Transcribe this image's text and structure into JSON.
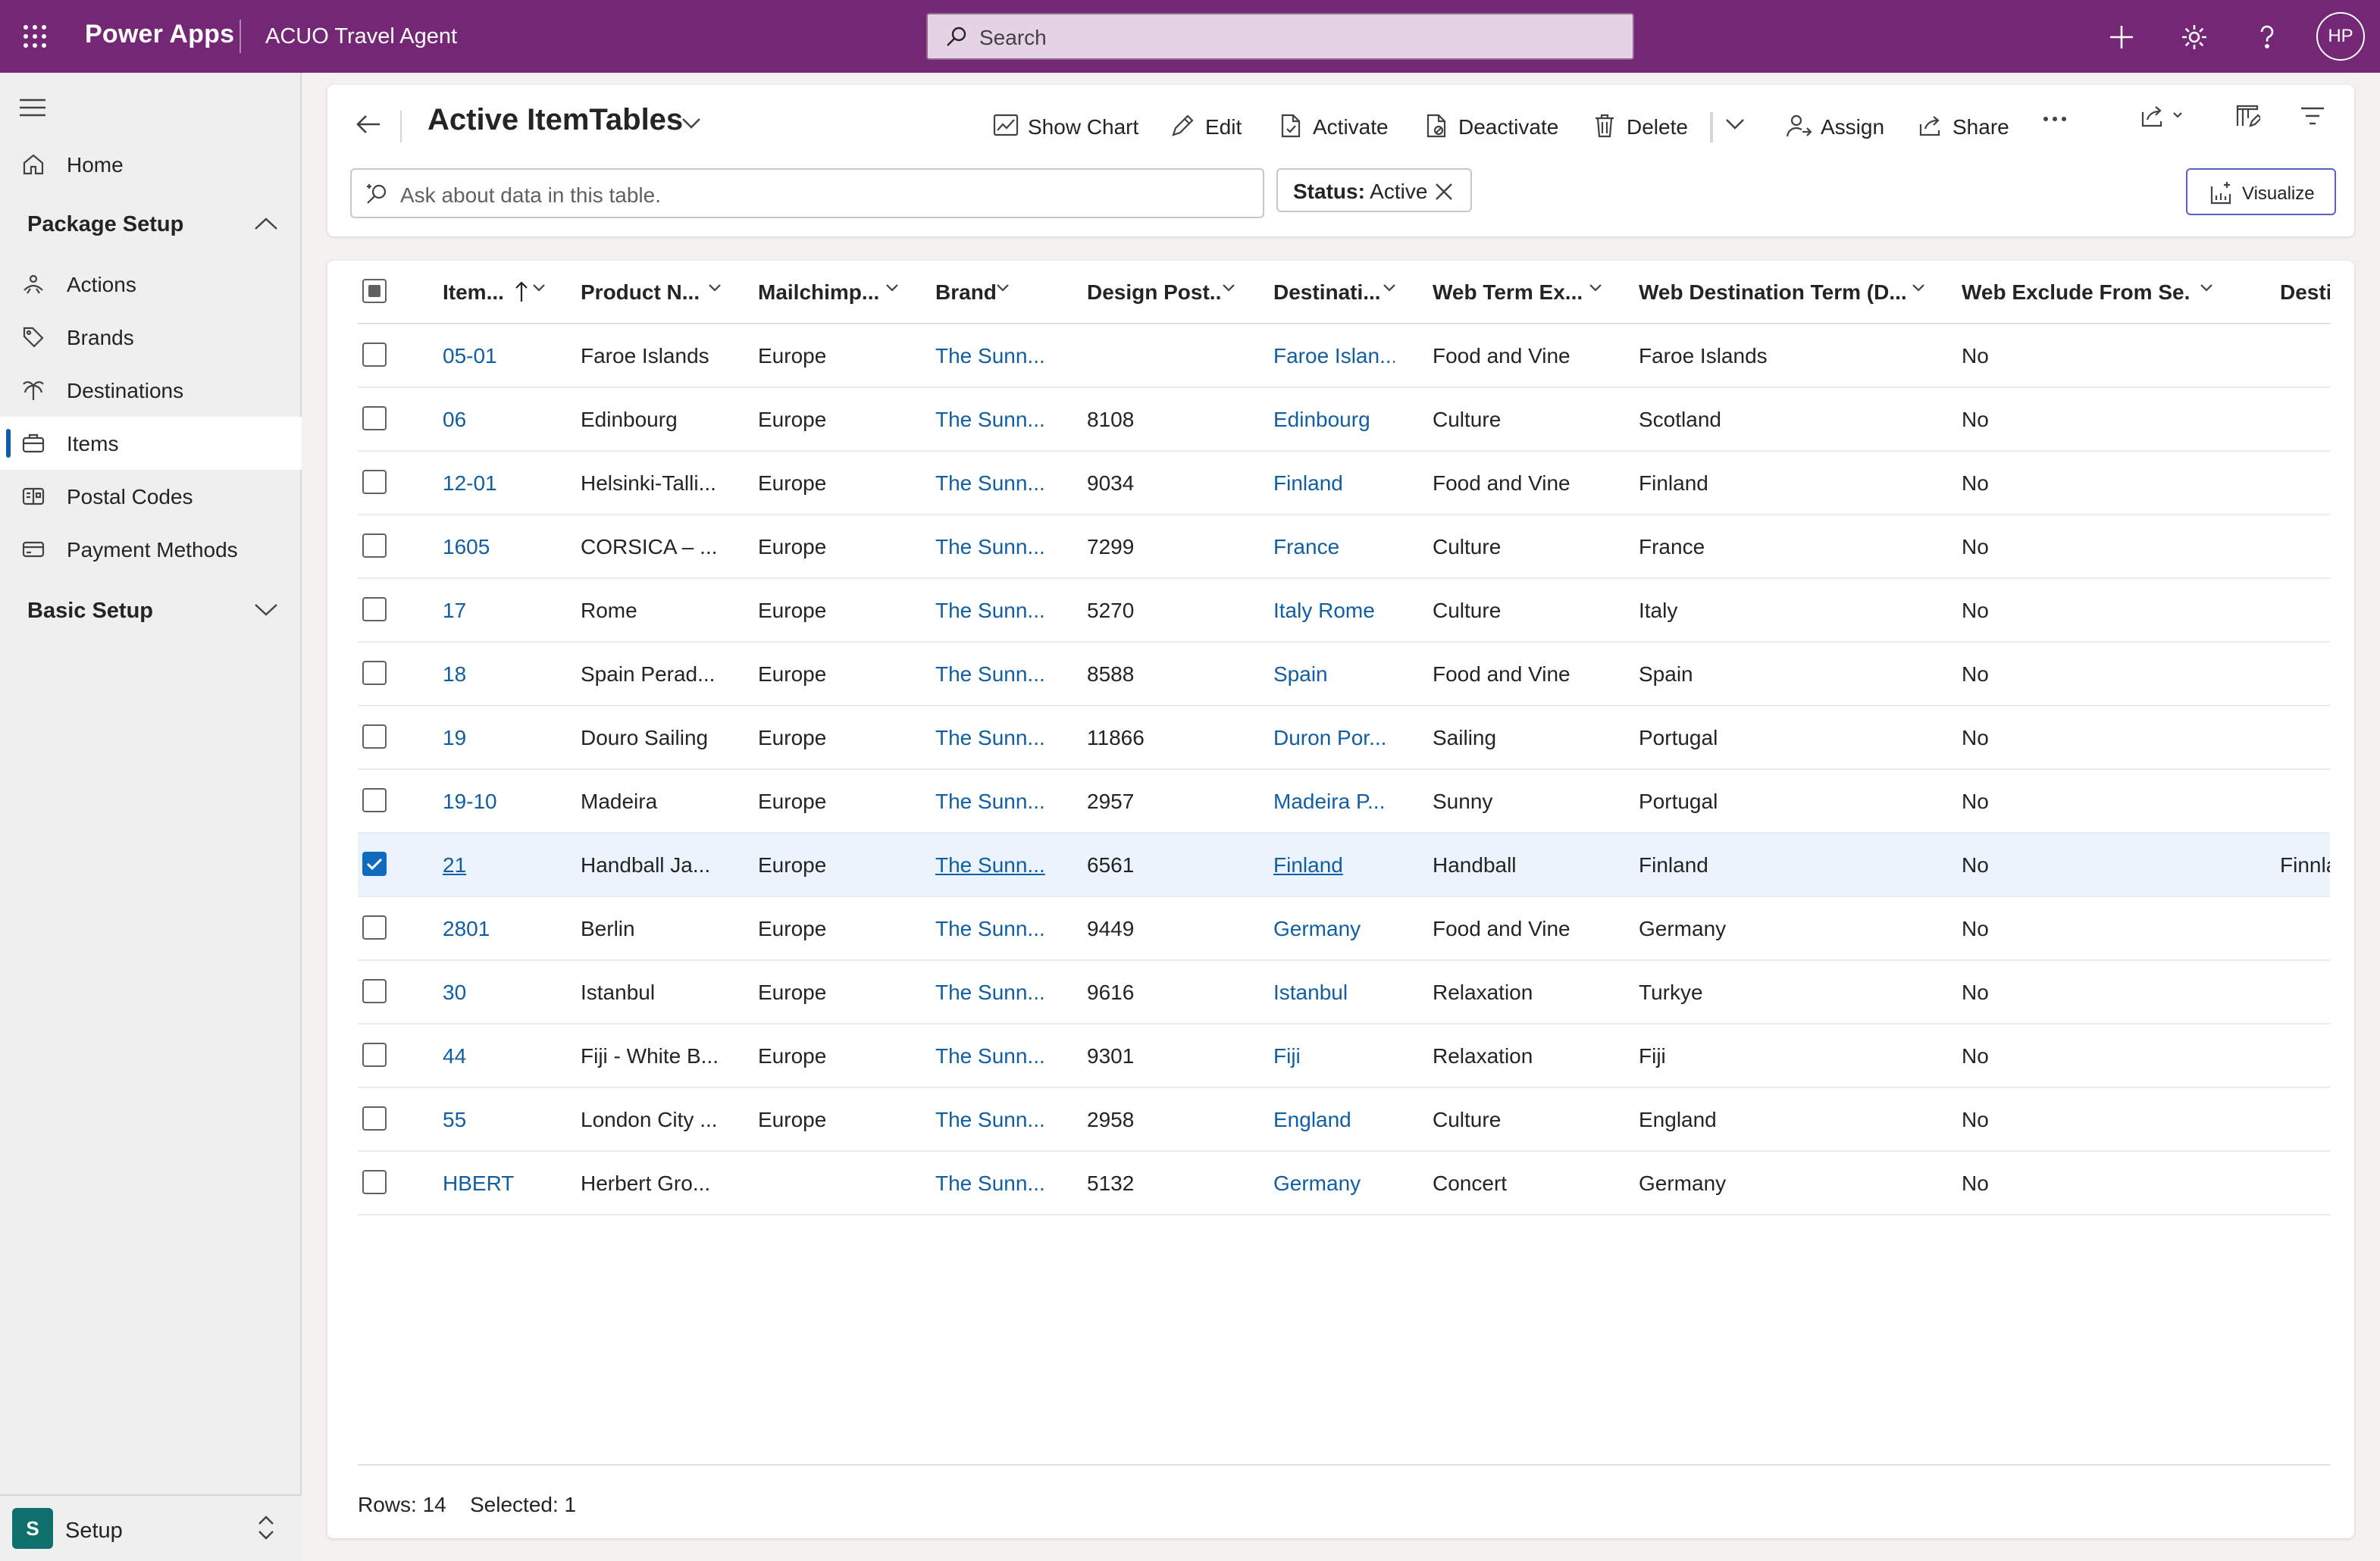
{
  "topbar": {
    "app_name": "Power Apps",
    "environment": "ACUO Travel Agent",
    "search_placeholder": "Search",
    "avatar_initials": "HP"
  },
  "sidebar": {
    "items": [
      {
        "label": "Home",
        "icon": "home-icon"
      },
      {
        "label": "Actions",
        "icon": "actions-icon"
      },
      {
        "label": "Brands",
        "icon": "tag-icon"
      },
      {
        "label": "Destinations",
        "icon": "palm-tree-icon"
      },
      {
        "label": "Items",
        "icon": "suitcase-icon",
        "selected": true
      },
      {
        "label": "Postal Codes",
        "icon": "postal-icon"
      },
      {
        "label": "Payment Methods",
        "icon": "payment-card-icon"
      }
    ],
    "groups": [
      {
        "label": "Package Setup",
        "expanded": true
      },
      {
        "label": "Basic Setup",
        "expanded": false
      }
    ],
    "area": {
      "badge": "S",
      "label": "Setup"
    }
  },
  "commandbar": {
    "view_title": "Active ItemTables",
    "buttons": {
      "show_chart": "Show Chart",
      "edit": "Edit",
      "activate": "Activate",
      "deactivate": "Deactivate",
      "delete": "Delete",
      "assign": "Assign",
      "share": "Share"
    },
    "ask_placeholder": "Ask about data in this table.",
    "filter_chip": {
      "label": "Status:",
      "value": "Active"
    },
    "visualize": "Visualize"
  },
  "grid": {
    "columns": [
      "Item...",
      "Product N...",
      "Mailchimp...",
      "Brand",
      "Design Post...",
      "Destinati...",
      "Web Term Ex...",
      "Web Destination Term (D...",
      "Web Exclude From Se...",
      "Destin"
    ],
    "rows": [
      {
        "item": "05-01",
        "product": "Faroe Islands",
        "mailchimp": "Europe",
        "brand": "The Sunn...",
        "design_post": "",
        "destination": "Faroe Islan...",
        "web_term": "Food and Vine",
        "web_dest_term": "Faroe Islands",
        "web_exclude": "No",
        "extra": ""
      },
      {
        "item": "06",
        "product": "Edinbourg",
        "mailchimp": "Europe",
        "brand": "The Sunn...",
        "design_post": "8108",
        "destination": "Edinbourg",
        "web_term": "Culture",
        "web_dest_term": "Scotland",
        "web_exclude": "No",
        "extra": ""
      },
      {
        "item": "12-01",
        "product": "Helsinki-Talli...",
        "mailchimp": "Europe",
        "brand": "The Sunn...",
        "design_post": "9034",
        "destination": "Finland",
        "web_term": "Food and Vine",
        "web_dest_term": "Finland",
        "web_exclude": "No",
        "extra": ""
      },
      {
        "item": "1605",
        "product": "CORSICA – ...",
        "mailchimp": "Europe",
        "brand": "The Sunn...",
        "design_post": "7299",
        "destination": "France",
        "web_term": "Culture",
        "web_dest_term": "France",
        "web_exclude": "No",
        "extra": ""
      },
      {
        "item": "17",
        "product": "Rome",
        "mailchimp": "Europe",
        "brand": "The Sunn...",
        "design_post": "5270",
        "destination": "Italy Rome",
        "web_term": "Culture",
        "web_dest_term": "Italy",
        "web_exclude": "No",
        "extra": ""
      },
      {
        "item": "18",
        "product": "Spain Perad...",
        "mailchimp": "Europe",
        "brand": "The Sunn...",
        "design_post": "8588",
        "destination": "Spain",
        "web_term": "Food and Vine",
        "web_dest_term": "Spain",
        "web_exclude": "No",
        "extra": ""
      },
      {
        "item": "19",
        "product": "Douro Sailing",
        "mailchimp": "Europe",
        "brand": "The Sunn...",
        "design_post": "11866",
        "destination": "Duron Por...",
        "web_term": "Sailing",
        "web_dest_term": "Portugal",
        "web_exclude": "No",
        "extra": ""
      },
      {
        "item": "19-10",
        "product": "Madeira",
        "mailchimp": "Europe",
        "brand": "The Sunn...",
        "design_post": "2957",
        "destination": "Madeira P...",
        "web_term": "Sunny",
        "web_dest_term": "Portugal",
        "web_exclude": "No",
        "extra": ""
      },
      {
        "item": "21",
        "product": "Handball Ja...",
        "mailchimp": "Europe",
        "brand": "The Sunn...",
        "design_post": "6561",
        "destination": "Finland",
        "web_term": "Handball",
        "web_dest_term": "Finland",
        "web_exclude": "No",
        "extra": "Finnla",
        "selected": true
      },
      {
        "item": "2801",
        "product": "Berlin",
        "mailchimp": "Europe",
        "brand": "The Sunn...",
        "design_post": "9449",
        "destination": "Germany",
        "web_term": "Food and Vine",
        "web_dest_term": "Germany",
        "web_exclude": "No",
        "extra": ""
      },
      {
        "item": "30",
        "product": "Istanbul",
        "mailchimp": "Europe",
        "brand": "The Sunn...",
        "design_post": "9616",
        "destination": "Istanbul",
        "web_term": "Relaxation",
        "web_dest_term": "Turkye",
        "web_exclude": "No",
        "extra": ""
      },
      {
        "item": "44",
        "product": "Fiji - White B...",
        "mailchimp": "Europe",
        "brand": "The Sunn...",
        "design_post": "9301",
        "destination": "Fiji",
        "web_term": "Relaxation",
        "web_dest_term": "Fiji",
        "web_exclude": "No",
        "extra": ""
      },
      {
        "item": "55",
        "product": "London City ...",
        "mailchimp": "Europe",
        "brand": "The Sunn...",
        "design_post": "2958",
        "destination": "England",
        "web_term": "Culture",
        "web_dest_term": "England",
        "web_exclude": "No",
        "extra": ""
      },
      {
        "item": "HBERT",
        "product": "Herbert Gro...",
        "mailchimp": "",
        "brand": "The Sunn...",
        "design_post": "5132",
        "destination": "Germany",
        "web_term": "Concert",
        "web_dest_term": "Germany",
        "web_exclude": "No",
        "extra": ""
      }
    ],
    "footer": {
      "rows": "Rows: 14",
      "selected": "Selected: 1"
    }
  },
  "colors": {
    "topbar": "#742774",
    "link": "#115ea3",
    "checkbox_checked": "#0f6cbd",
    "selected_row": "#ebf3fc",
    "area_badge": "#0f6f6c"
  }
}
